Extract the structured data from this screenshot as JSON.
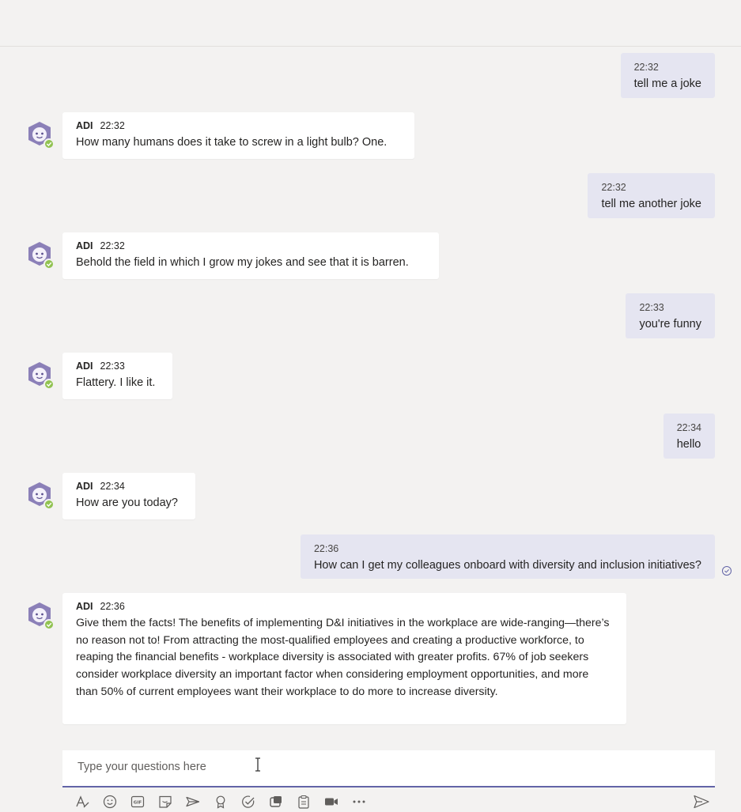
{
  "conversation": {
    "messages": [
      {
        "kind": "sent",
        "time": "22:32",
        "text": "tell me a joke"
      },
      {
        "kind": "received",
        "sender": "ADI",
        "time": "22:32",
        "text": "How many humans does it take to screw in a light bulb? One."
      },
      {
        "kind": "sent",
        "time": "22:32",
        "text": "tell me another joke"
      },
      {
        "kind": "received",
        "sender": "ADI",
        "time": "22:32",
        "text": "Behold the field in which I grow my jokes and see that it is barren."
      },
      {
        "kind": "sent",
        "time": "22:33",
        "text": "you're funny"
      },
      {
        "kind": "received",
        "sender": "ADI",
        "time": "22:33",
        "text": "Flattery. I like it."
      },
      {
        "kind": "sent",
        "time": "22:34",
        "text": "hello"
      },
      {
        "kind": "received",
        "sender": "ADI",
        "time": "22:34",
        "text": "How are you today?"
      },
      {
        "kind": "sent",
        "time": "22:36",
        "text": "How can I get my colleagues onboard with diversity and inclusion initiatives?"
      },
      {
        "kind": "received",
        "sender": "ADI",
        "time": "22:36",
        "text": "Give them the facts! The benefits of implementing D&I initiatives in the workplace are wide-ranging—there’s no reason not to! From attracting the most-qualified employees and creating a productive workforce, to reaping the financial benefits - workplace diversity is associated with greater profits. 67% of job seekers consider workplace diversity an important factor when considering employment opportunities, and more than 50% of current employees want their workplace to do more to increase diversity."
      }
    ]
  },
  "compose": {
    "placeholder": "Type your questions here",
    "value": ""
  },
  "toolbar": {
    "icons": [
      "format-icon",
      "emoji-icon",
      "gif-icon",
      "sticker-icon",
      "meet-now-icon",
      "praise-icon",
      "approvals-icon",
      "loop-icon",
      "clipboard-icon",
      "video-icon",
      "more-options-icon"
    ]
  },
  "colors": {
    "accent": "#6264a7",
    "sent_bubble": "#e5e5f1",
    "received_bubble": "#ffffff",
    "background": "#f3f2f1",
    "presence": "#92c353"
  }
}
